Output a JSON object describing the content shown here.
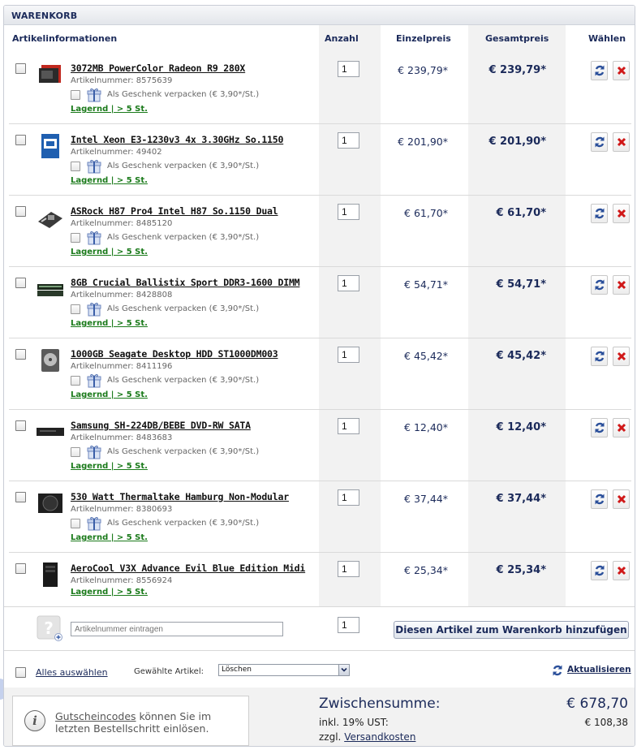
{
  "panel": {
    "title": "WARENKORB"
  },
  "columns": {
    "info": "Artikelinformationen",
    "qty": "Anzahl",
    "unit_price": "Einzelpreis",
    "total_price": "Gesamtpreis",
    "select": "Wählen"
  },
  "items": [
    {
      "title": "3072MB PowerColor Radeon R9 280X",
      "artnr": "Artikelnummer: 8575639",
      "gift": "Als Geschenk verpacken (€ 3,90*/St.)",
      "stock": "Lagernd | > 5 St.",
      "qty": "1",
      "price": "€ 239,79*",
      "total": "€ 239,79*",
      "thumb": "gpu"
    },
    {
      "title": "Intel Xeon E3-1230v3 4x 3.30GHz So.1150",
      "artnr": "Artikelnummer: 49402",
      "gift": "Als Geschenk verpacken (€ 3,90*/St.)",
      "stock": "Lagernd | > 5 St.",
      "qty": "1",
      "price": "€ 201,90*",
      "total": "€ 201,90*",
      "thumb": "cpu"
    },
    {
      "title": "ASRock H87 Pro4 Intel H87 So.1150 Dual",
      "artnr": "Artikelnummer: 8485120",
      "gift": "Als Geschenk verpacken (€ 3,90*/St.)",
      "stock": "Lagernd | > 5 St.",
      "qty": "1",
      "price": "€ 61,70*",
      "total": "€ 61,70*",
      "thumb": "board"
    },
    {
      "title": "8GB Crucial Ballistix Sport DDR3-1600 DIMM",
      "artnr": "Artikelnummer: 8428808",
      "gift": "Als Geschenk verpacken (€ 3,90*/St.)",
      "stock": "Lagernd | > 5 St.",
      "qty": "1",
      "price": "€ 54,71*",
      "total": "€ 54,71*",
      "thumb": "ram"
    },
    {
      "title": "1000GB Seagate Desktop HDD ST1000DM003",
      "artnr": "Artikelnummer: 8411196",
      "gift": "Als Geschenk verpacken (€ 3,90*/St.)",
      "stock": "Lagernd | > 5 St.",
      "qty": "1",
      "price": "€ 45,42*",
      "total": "€ 45,42*",
      "thumb": "hdd"
    },
    {
      "title": "Samsung SH-224DB/BEBE DVD-RW SATA",
      "artnr": "Artikelnummer: 8483683",
      "gift": "Als Geschenk verpacken (€ 3,90*/St.)",
      "stock": "Lagernd | > 5 St.",
      "qty": "1",
      "price": "€ 12,40*",
      "total": "€ 12,40*",
      "thumb": "dvd"
    },
    {
      "title": "530 Watt Thermaltake Hamburg Non-Modular",
      "artnr": "Artikelnummer: 8380693",
      "gift": "Als Geschenk verpacken (€ 3,90*/St.)",
      "stock": "Lagernd | > 5 St.",
      "qty": "1",
      "price": "€ 37,44*",
      "total": "€ 37,44*",
      "thumb": "psu"
    },
    {
      "title": "AeroCool V3X Advance Evil Blue Edition Midi",
      "artnr": "Artikelnummer: 8556924",
      "gift": null,
      "stock": "Lagernd | > 5 St.",
      "qty": "1",
      "price": "€ 25,34*",
      "total": "€ 25,34*",
      "thumb": "case"
    }
  ],
  "add_item": {
    "placeholder": "Artikelnummer eintragen",
    "qty": "1",
    "button": "Diesen Artikel zum Warenkorb hinzufügen"
  },
  "actions": {
    "select_all": "Alles auswählen",
    "selected_label": "Gewählte Artikel:",
    "selected_option": "Löschen",
    "refresh": "Aktualisieren"
  },
  "footer": {
    "coupon_link": "Gutscheincodes",
    "coupon_rest": " können Sie im",
    "coupon_line2": "letzten Bestellschritt einlösen.",
    "subtotal_label": "Zwischensumme:",
    "subtotal": "€ 678,70",
    "tax_label": "inkl. 19% UST:",
    "tax": "€ 108,38",
    "shipping_prefix": "zzgl. ",
    "shipping_link": "Versandkosten"
  }
}
